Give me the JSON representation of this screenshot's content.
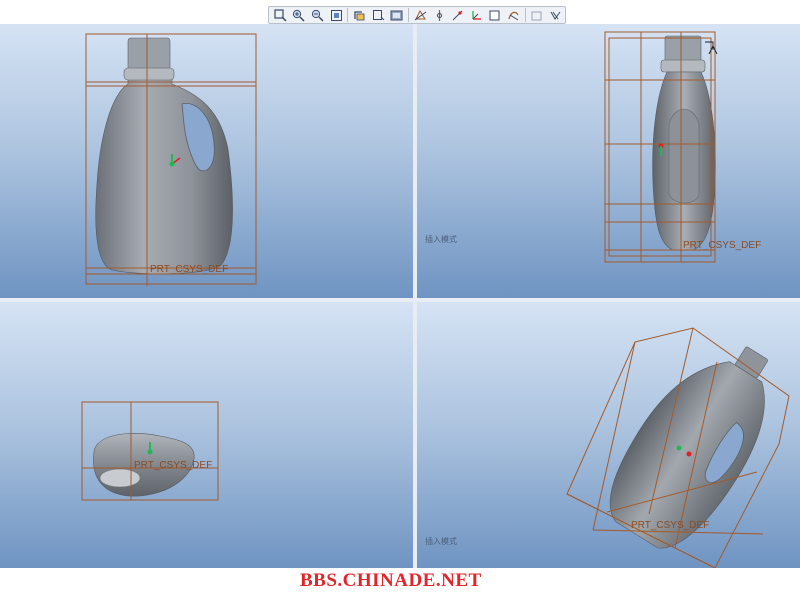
{
  "toolbar": {
    "buttons": [
      {
        "icon": "zoom-window-icon"
      },
      {
        "icon": "zoom-in-icon"
      },
      {
        "icon": "zoom-out-icon"
      },
      {
        "icon": "refit-icon"
      },
      {
        "icon": "orient-icon"
      },
      {
        "icon": "saved-views-icon"
      },
      {
        "icon": "display-style-icon"
      },
      {
        "icon": "datum-planes-icon"
      },
      {
        "icon": "datum-axes-icon"
      },
      {
        "icon": "datum-points-icon"
      },
      {
        "icon": "coordinate-system-icon"
      },
      {
        "icon": "annotation-icon"
      },
      {
        "icon": "spin-center-icon"
      }
    ]
  },
  "viewports": {
    "front": {
      "csys_label": "PRT_CSYS_DEF"
    },
    "right": {
      "csys_label": "PRT_CSYS_DEF",
      "hint": "插入模式"
    },
    "top": {
      "csys_label": "PRT_CSYS_DEF"
    },
    "iso": {
      "csys_label": "PRT_CSYS_DEF",
      "hint": "插入模式"
    }
  },
  "colors": {
    "bbox": "#a35a2a",
    "body": "#8f949b",
    "csys_green": "#1db954",
    "csys_red": "#e02020",
    "watermark": "#e0262b"
  },
  "watermark": "BBS.CHINADE.NET"
}
